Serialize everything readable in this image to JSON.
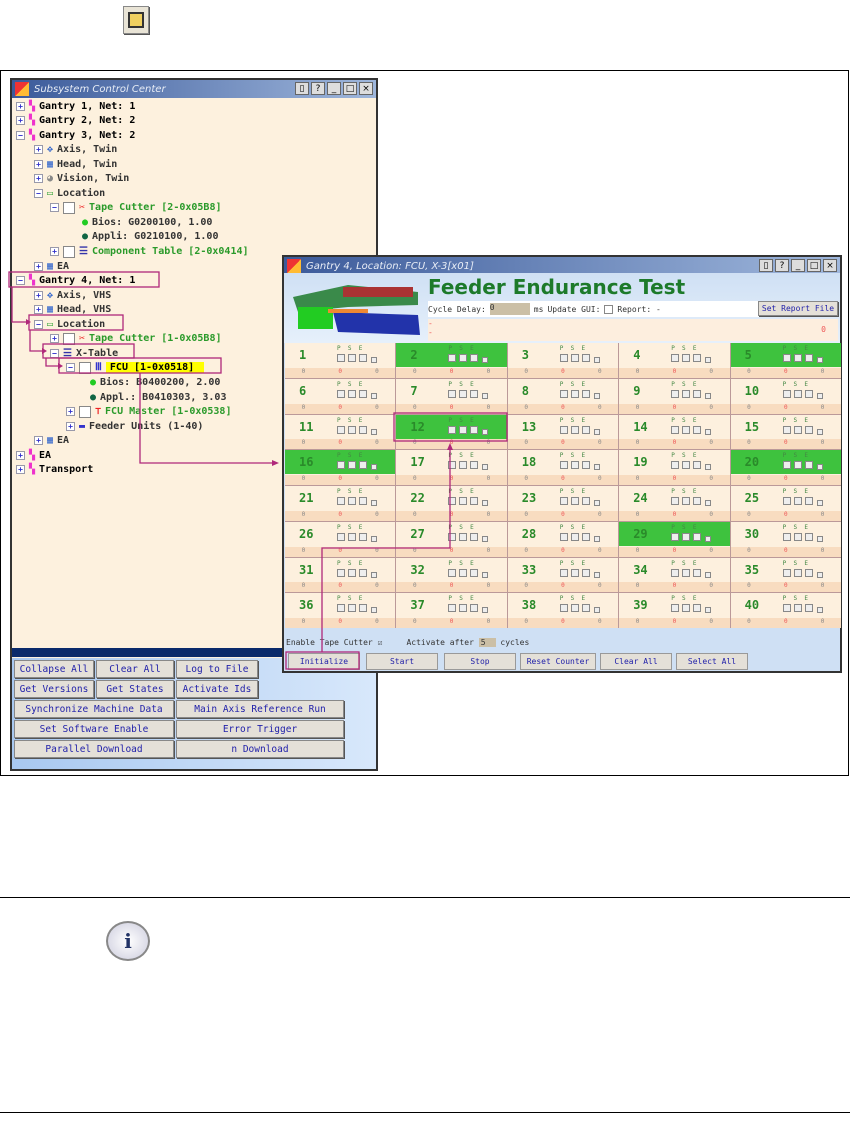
{
  "left_window": {
    "title": "Subsystem Control Center",
    "tree": [
      {
        "label": "Gantry 1, Net: 1",
        "lvl": 0,
        "exp": "+",
        "icon": "gantry",
        "style": "top"
      },
      {
        "label": "Gantry 2, Net: 2",
        "lvl": 0,
        "exp": "+",
        "icon": "gantry",
        "style": "top"
      },
      {
        "label": "Gantry 3, Net: 2",
        "lvl": 0,
        "exp": "-",
        "icon": "gantry",
        "style": "top"
      },
      {
        "label": "Axis, Twin",
        "lvl": 1,
        "exp": "+",
        "icon": "axis"
      },
      {
        "label": "Head, Twin",
        "lvl": 1,
        "exp": "+",
        "icon": "head"
      },
      {
        "label": "Vision, Twin",
        "lvl": 1,
        "exp": "+",
        "icon": "vision"
      },
      {
        "label": "Location",
        "lvl": 1,
        "exp": "-",
        "icon": "location"
      },
      {
        "label": "Tape Cutter [2-0x05B8]",
        "lvl": 2,
        "exp": "-",
        "icon": "scissors",
        "chk": true,
        "style": "green"
      },
      {
        "label": "Bios: G0200100, 1.00",
        "lvl": 4,
        "icon": "dot-green"
      },
      {
        "label": "Appli: G0210100, 1.00",
        "lvl": 4,
        "icon": "dot-dark"
      },
      {
        "label": "Component Table [2-0x0414]",
        "lvl": 2,
        "exp": "+",
        "icon": "table",
        "chk": true,
        "style": "green"
      },
      {
        "label": "EA",
        "lvl": 1,
        "exp": "+",
        "icon": "ea"
      },
      {
        "label": "Gantry 4, Net: 1",
        "lvl": 0,
        "exp": "-",
        "icon": "gantry",
        "style": "top"
      },
      {
        "label": "Axis, VHS",
        "lvl": 1,
        "exp": "+",
        "icon": "axis"
      },
      {
        "label": "Head, VHS",
        "lvl": 1,
        "exp": "+",
        "icon": "head"
      },
      {
        "label": "Location",
        "lvl": 1,
        "exp": "-",
        "icon": "location"
      },
      {
        "label": "Tape Cutter [1-0x05B8]",
        "lvl": 2,
        "exp": "+",
        "icon": "scissors",
        "chk": true,
        "style": "green"
      },
      {
        "label": "X-Table",
        "lvl": 2,
        "exp": "-",
        "icon": "table"
      },
      {
        "label": "FCU [1-0x0518]",
        "lvl": 3,
        "exp": "-",
        "icon": "fcu",
        "chk": true,
        "style": "hl"
      },
      {
        "label": "Bios: B0400200, 2.00",
        "lvl": 5,
        "icon": "dot-green"
      },
      {
        "label": "Appl.: B0410303, 3.03",
        "lvl": 5,
        "icon": "dot-dark"
      },
      {
        "label": "FCU Master [1-0x0538]",
        "lvl": 3,
        "exp": "+",
        "icon": "fcu-master",
        "chk": true,
        "style": "green"
      },
      {
        "label": "Feeder Units (1-40)",
        "lvl": 3,
        "exp": "+",
        "icon": "feeder"
      },
      {
        "label": "EA",
        "lvl": 1,
        "exp": "+",
        "icon": "ea"
      },
      {
        "label": "EA",
        "lvl": 0,
        "exp": "+",
        "icon": "gantry",
        "style": "top"
      },
      {
        "label": "Transport",
        "lvl": 0,
        "exp": "+",
        "icon": "gantry",
        "style": "top"
      }
    ],
    "buttons": [
      "Collapse All",
      "Clear All",
      "Log to File",
      "Get Versions",
      "Get States",
      "Activate Ids",
      "Synchronize Machine Data",
      "Main Axis Reference Run",
      "Set Software Enable",
      "Error Trigger",
      "Parallel Download",
      "n Download"
    ]
  },
  "right_window": {
    "title": "Gantry 4, Location: FCU, X-3[x01]",
    "heading": "Feeder Endurance Test",
    "cycle_delay_label": "Cycle Delay:",
    "cycle_delay_value": "0",
    "cycle_delay_unit": "ms",
    "update_gui_label": "Update GUI:",
    "report_label": "Report: -",
    "set_report_button": "Set Report File",
    "msg_lines": [
      "-",
      "-"
    ],
    "error_count": "0",
    "feeders": [
      "1",
      "2",
      "3",
      "4",
      "5",
      "6",
      "7",
      "8",
      "9",
      "10",
      "11",
      "12",
      "13",
      "14",
      "15",
      "16",
      "17",
      "18",
      "19",
      "20",
      "21",
      "22",
      "23",
      "24",
      "25",
      "26",
      "27",
      "28",
      "29",
      "30",
      "31",
      "32",
      "33",
      "34",
      "35",
      "36",
      "37",
      "38",
      "39",
      "40"
    ],
    "active_feeders": [
      "2",
      "5",
      "12",
      "16",
      "20",
      "29"
    ],
    "check_labels": [
      "P",
      "S",
      "E"
    ],
    "counters": [
      "0",
      "0",
      "0"
    ],
    "enable_label": "Enable Tape Cutter",
    "activate_label": "Activate after",
    "activate_value": "5",
    "cycles_label": "cycles",
    "buttons": [
      "Initialize",
      "Start",
      "Stop",
      "Reset Counter",
      "Clear All",
      "Select All"
    ]
  },
  "colors": {
    "annotation": "#b0287a",
    "active": "#3ec23e"
  }
}
